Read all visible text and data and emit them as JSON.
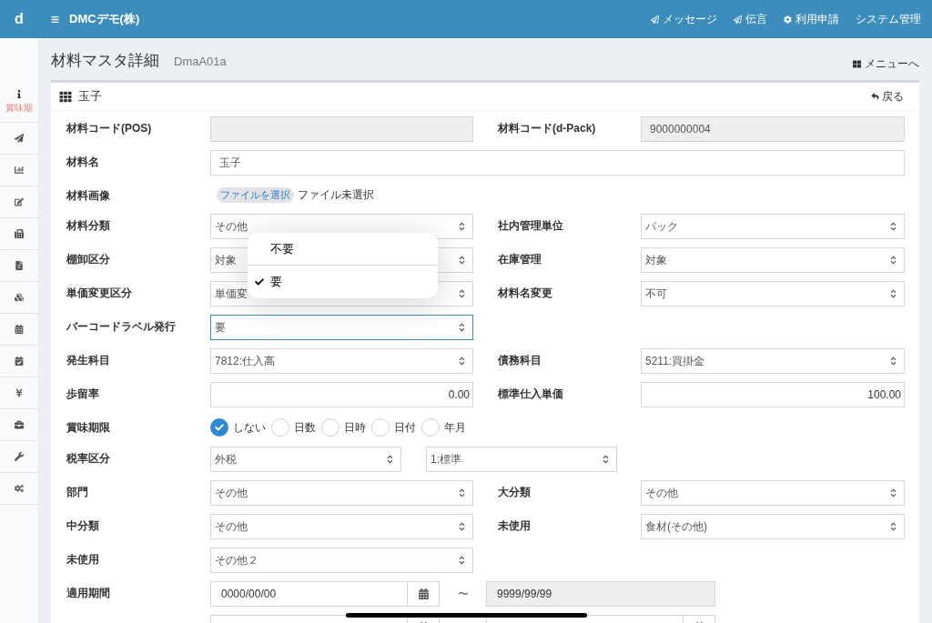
{
  "header": {
    "brand": "d",
    "company": "DMCデモ(株)",
    "nav": [
      {
        "label": "メッセージ"
      },
      {
        "label": "伝言"
      },
      {
        "label": "利用申請"
      },
      {
        "label": "システム管理"
      }
    ]
  },
  "sidebar": {
    "info_label": "賞味期"
  },
  "page": {
    "title": "材料マスタ詳細",
    "code": "DmaA01a",
    "menu_link": "メニューへ"
  },
  "panel": {
    "title": "玉子",
    "back": "戻る"
  },
  "form": [
    {
      "kind": "pair",
      "fields": [
        {
          "label": "材料コード(POS)",
          "kind": "text",
          "disabled": true
        },
        {
          "label": "材料コード(d-Pack)",
          "kind": "text",
          "disabled": true,
          "value": "9000000004"
        }
      ]
    },
    {
      "kind": "wide",
      "fields": [
        {
          "label": "材料名",
          "kind": "text",
          "disabled": false,
          "value": "玉子"
        }
      ]
    },
    {
      "kind": "pair",
      "fields": [
        {
          "label": "材料画像",
          "kind": "file",
          "button": "ファイルを選択",
          "status": "ファイル未選択"
        }
      ]
    },
    {
      "kind": "pair",
      "fields": [
        {
          "label": "材料分類",
          "kind": "select",
          "focused": false,
          "value": "その他"
        },
        {
          "label": "社内管理単位",
          "kind": "select",
          "focused": false,
          "value": "パック"
        }
      ]
    },
    {
      "kind": "pair",
      "fields": [
        {
          "label": "棚卸区分",
          "kind": "select",
          "focused": false,
          "value": "対象"
        },
        {
          "label": "在庫管理",
          "kind": "select",
          "focused": false,
          "value": "対象"
        }
      ]
    },
    {
      "kind": "pair",
      "fields": [
        {
          "label": "単価変更区分",
          "kind": "select",
          "focused": false,
          "value": "単価変"
        },
        {
          "label": "材料名変更",
          "kind": "select",
          "focused": false,
          "value": "不可"
        }
      ]
    },
    {
      "kind": "pair",
      "fields": [
        {
          "label": "バーコードラベル発行",
          "kind": "select",
          "focused": true,
          "value": "要"
        }
      ]
    },
    {
      "kind": "pair",
      "fields": [
        {
          "label": "発生科目",
          "kind": "select",
          "focused": false,
          "value": "7812:仕入高"
        },
        {
          "label": "債務科目",
          "kind": "select",
          "focused": false,
          "value": "5211:買掛金"
        }
      ]
    },
    {
      "kind": "pair",
      "fields": [
        {
          "label": "歩留率",
          "kind": "number",
          "value": "0.00"
        },
        {
          "label": "標準仕入単価",
          "kind": "number",
          "value": "100.00"
        }
      ]
    },
    {
      "kind": "pair",
      "fields": [
        {
          "label": "賞味期限",
          "kind": "radio",
          "options": [
            {
              "label": "しない",
              "selected": true
            },
            {
              "label": "日数",
              "selected": false
            },
            {
              "label": "日時",
              "selected": false
            },
            {
              "label": "日付",
              "selected": false
            },
            {
              "label": "年月",
              "selected": false
            }
          ]
        }
      ]
    },
    {
      "kind": "pair",
      "fields": [
        {
          "label": "税率区分",
          "kind": "select_pair",
          "values": [
            "外税",
            "1:標準"
          ]
        }
      ]
    },
    {
      "kind": "pair",
      "fields": [
        {
          "label": "部門",
          "kind": "select",
          "focused": false,
          "value": "その他"
        },
        {
          "label": "大分類",
          "kind": "select",
          "focused": false,
          "value": "その他"
        }
      ]
    },
    {
      "kind": "pair",
      "fields": [
        {
          "label": "中分類",
          "kind": "select",
          "focused": false,
          "value": "その他"
        },
        {
          "label": "未使用",
          "kind": "select",
          "focused": false,
          "value": "食材(その他)"
        }
      ]
    },
    {
      "kind": "pair",
      "fields": [
        {
          "label": "未使用",
          "kind": "select",
          "focused": false,
          "value": "その他２"
        }
      ]
    },
    {
      "kind": "pair",
      "fields": [
        {
          "label": "適用期間",
          "kind": "date_range",
          "from": {
            "value": "0000/00/00",
            "disabled": false
          },
          "separator": "〜",
          "to": {
            "value": "9999/99/99",
            "disabled": true
          }
        }
      ]
    },
    {
      "kind": "pair",
      "fields": [
        {
          "kind": "date_range",
          "from": {
            "disabled": false
          },
          "to": {
            "disabled": false
          }
        }
      ]
    }
  ],
  "picker": {
    "options": [
      {
        "label": "不要",
        "selected": false
      },
      {
        "label": "要",
        "selected": true
      }
    ]
  }
}
